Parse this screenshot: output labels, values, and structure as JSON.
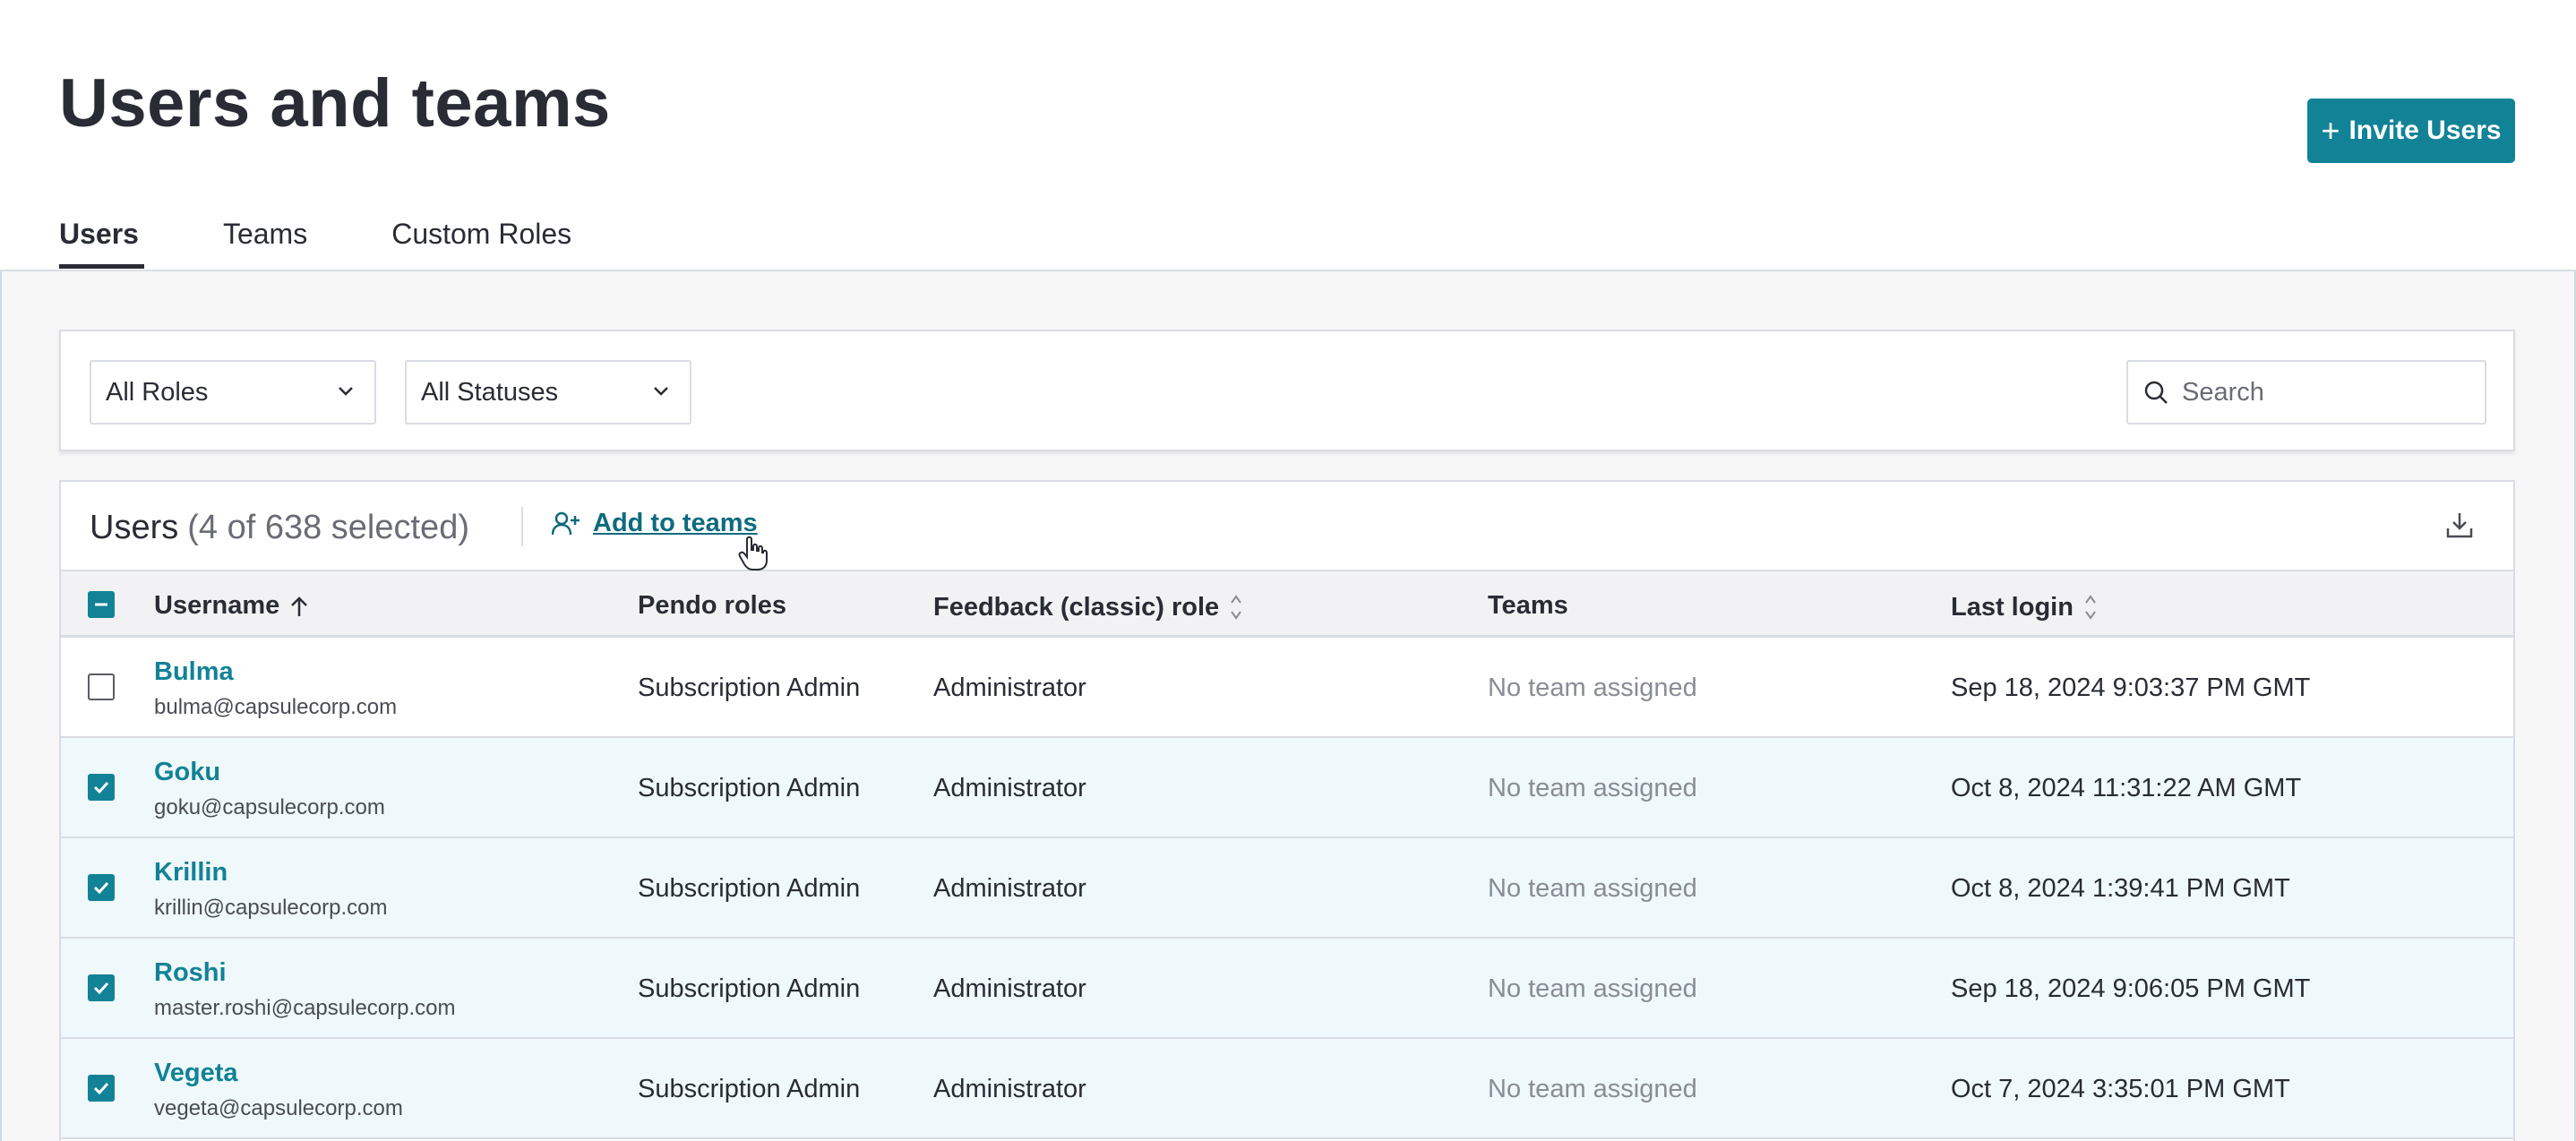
{
  "page": {
    "title": "Users and teams",
    "invite_label": "Invite Users"
  },
  "tabs": [
    {
      "label": "Users",
      "active": true
    },
    {
      "label": "Teams",
      "active": false
    },
    {
      "label": "Custom Roles",
      "active": false
    }
  ],
  "filters": {
    "roles": "All Roles",
    "statuses": "All Statuses",
    "search_placeholder": "Search"
  },
  "table": {
    "title": "Users",
    "count": "(4 of 638 selected)",
    "add_to_teams": "Add to teams",
    "columns": {
      "username": "Username",
      "pendo_roles": "Pendo roles",
      "feedback_role": "Feedback (classic) role",
      "teams": "Teams",
      "last_login": "Last login"
    },
    "rows": [
      {
        "name": "Bulma",
        "email": "bulma@capsulecorp.com",
        "pendo": "Subscription Admin",
        "feedback": "Administrator",
        "teams": "No team assigned",
        "login": "Sep 18, 2024 9:03:37 PM GMT",
        "selected": false
      },
      {
        "name": "Goku",
        "email": "goku@capsulecorp.com",
        "pendo": "Subscription Admin",
        "feedback": "Administrator",
        "teams": "No team assigned",
        "login": "Oct 8, 2024 11:31:22 AM GMT",
        "selected": true
      },
      {
        "name": "Krillin",
        "email": "krillin@capsulecorp.com",
        "pendo": "Subscription Admin",
        "feedback": "Administrator",
        "teams": "No team assigned",
        "login": "Oct 8, 2024 1:39:41 PM GMT",
        "selected": true
      },
      {
        "name": "Roshi",
        "email": "master.roshi@capsulecorp.com",
        "pendo": "Subscription Admin",
        "feedback": "Administrator",
        "teams": "No team assigned",
        "login": "Sep 18, 2024 9:06:05 PM GMT",
        "selected": true
      },
      {
        "name": "Vegeta",
        "email": "vegeta@capsulecorp.com",
        "pendo": "Subscription Admin",
        "feedback": "Administrator",
        "teams": "No team assigned",
        "login": "Oct 7, 2024 3:35:01 PM GMT",
        "selected": true
      }
    ]
  },
  "colors": {
    "accent": "#128297",
    "link": "#0e6b7d",
    "selected_row": "#eff8fa"
  },
  "icons": [
    "plus-icon",
    "chevron-down-icon",
    "search-icon",
    "user-plus-icon",
    "download-icon",
    "sort-asc-icon",
    "sort-icon",
    "check-icon",
    "hand-cursor-icon"
  ]
}
